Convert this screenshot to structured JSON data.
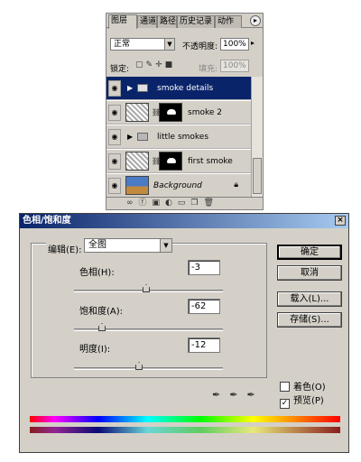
{
  "layers_panel": {
    "tabs": [
      {
        "label": "图层"
      },
      {
        "label": "通道"
      },
      {
        "label": "路径"
      },
      {
        "label": "历史记录"
      },
      {
        "label": "动作"
      }
    ],
    "blend_mode": "正常",
    "opacity_label": "不透明度:",
    "opacity_value": "100%",
    "lock_label": "锁定:",
    "fill_label": "填充:",
    "fill_value": "100%",
    "layers": [
      {
        "name": "smoke details",
        "kind": "group",
        "selected": true
      },
      {
        "name": "smoke 2",
        "kind": "masked-layer",
        "selected": false
      },
      {
        "name": "little smokes",
        "kind": "group",
        "selected": false
      },
      {
        "name": "first smoke",
        "kind": "masked-layer",
        "selected": false
      },
      {
        "name": "Background",
        "kind": "background",
        "selected": false
      }
    ]
  },
  "dialog": {
    "title": "色相/饱和度",
    "edit_label": "编辑(E):",
    "edit_value": "全图",
    "hue_label": "色相(H):",
    "hue_value": "-3",
    "saturation_label": "饱和度(A):",
    "saturation_value": "-62",
    "lightness_label": "明度(I):",
    "lightness_value": "-12",
    "buttons": {
      "ok": "确定",
      "cancel": "取消",
      "load": "载入(L)...",
      "save": "存储(S)..."
    },
    "colorize_label": "着色(O)",
    "colorize_checked": false,
    "preview_label": "预览(P)",
    "preview_checked": true
  }
}
